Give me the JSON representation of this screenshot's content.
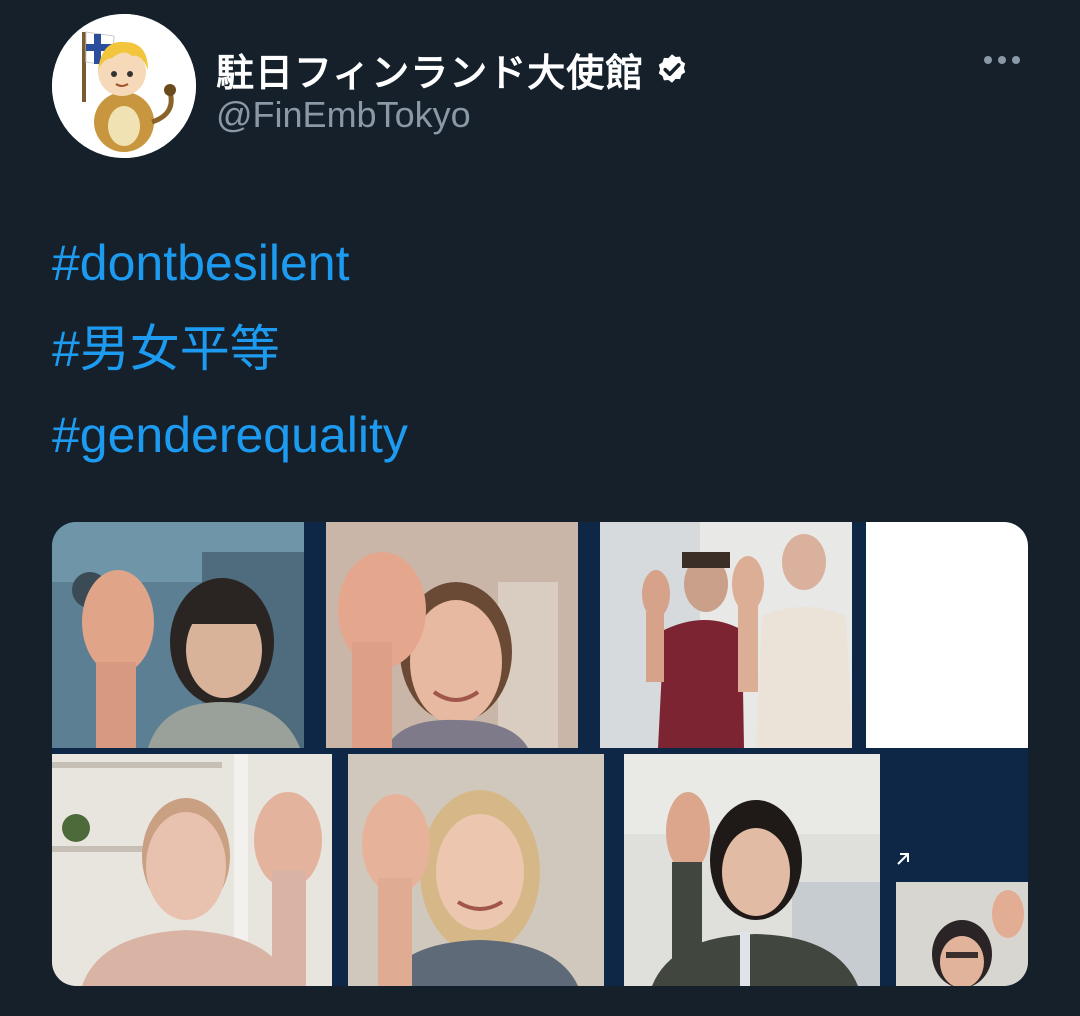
{
  "account": {
    "display_name": "駐日フィンランド大使館",
    "handle": "@FinEmbTokyo",
    "verified_icon": "verified-badge-icon",
    "more_icon": "more-options-icon",
    "avatar_icon": "mascot-avatar"
  },
  "tweet": {
    "hashtags": [
      "#dontbesilent",
      "#男女平等",
      "#genderequality"
    ]
  },
  "media": {
    "description_icon": "video-call-grid-image",
    "tiles": 9
  },
  "colors": {
    "background": "#15202b",
    "link": "#1d9bf0",
    "secondary_text": "#8b98a5",
    "media_bg": "#0e2747"
  }
}
